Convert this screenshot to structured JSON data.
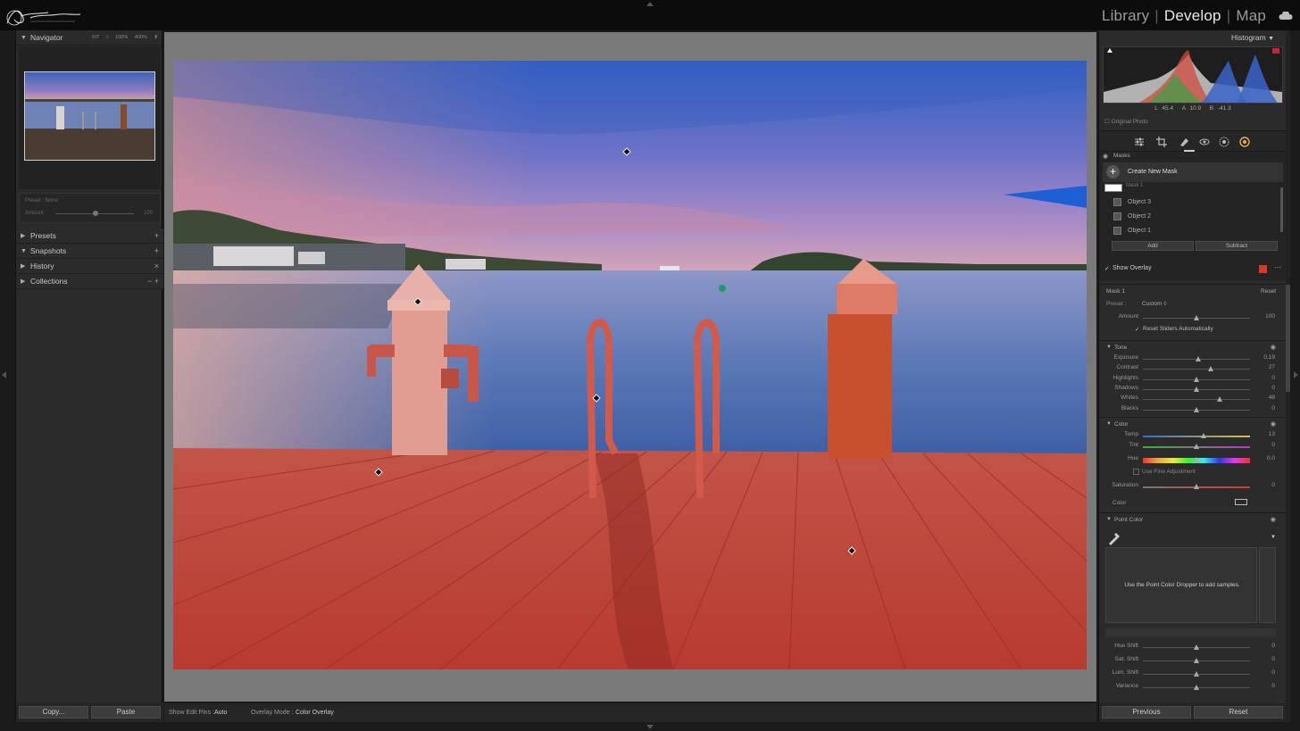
{
  "modules": {
    "library": "Library",
    "develop": "Develop",
    "map": "Map"
  },
  "navigator": {
    "title": "Navigator",
    "zoom_fit": "FIT ◊",
    "zoom_100": "100%",
    "zoom_400": "400%"
  },
  "preset_amount": {
    "preset_label": "Preset : None",
    "amount_label": "Amount",
    "amount_value": "100"
  },
  "left_sections": [
    {
      "label": "Presets",
      "action": "+"
    },
    {
      "label": "Snapshots",
      "action": "+"
    },
    {
      "label": "History",
      "action": "×"
    },
    {
      "label": "Collections",
      "action": "− +"
    }
  ],
  "left_buttons": {
    "copy": "Copy...",
    "paste": "Paste"
  },
  "toolbar": {
    "edit_pins_label": "Show Edit Pins :",
    "edit_pins_value": "Auto",
    "overlay_mode_label": "Overlay Mode :",
    "overlay_mode_value": "Color Overlay"
  },
  "histogram": {
    "title": "Histogram",
    "l_label": "L",
    "l_value": "45.4",
    "a_label": "A",
    "a_value": "10.9",
    "b_label": "B",
    "b_value": "-41.3",
    "original_photo": "Original Photo"
  },
  "masks": {
    "title": "Masks",
    "create_new": "Create New Mask",
    "mask_name": "Mask 1",
    "objects": [
      "Object 3",
      "Object 2",
      "Object 1"
    ],
    "add": "Add",
    "subtract": "Subtract",
    "show_overlay": "Show Overlay",
    "overlay_color": "#d83a2a"
  },
  "mask_panel": {
    "title": "Mask 1",
    "reset": "Reset",
    "preset_label": "Preset :",
    "preset_value": "Custom ◊",
    "amount_label": "Amount",
    "amount_value": "100",
    "reset_sliders": "Reset Sliders Automatically"
  },
  "tone": {
    "title": "Tone",
    "sliders": [
      {
        "label": "Exposure",
        "value": "0.19",
        "pos": 0.52
      },
      {
        "label": "Contrast",
        "value": "27",
        "pos": 0.63
      },
      {
        "label": "Highlights",
        "value": "0",
        "pos": 0.5
      },
      {
        "label": "Shadows",
        "value": "0",
        "pos": 0.5
      },
      {
        "label": "Whites",
        "value": "48",
        "pos": 0.72
      },
      {
        "label": "Blacks",
        "value": "0",
        "pos": 0.5
      }
    ]
  },
  "color": {
    "title": "Color",
    "temp_label": "Temp",
    "temp_value": "13",
    "temp_pos": 0.57,
    "tint_label": "Tint",
    "tint_value": "0",
    "tint_pos": 0.5,
    "hue_label": "Hue",
    "hue_value": "0.0",
    "hue_pos": 0.5,
    "fine_adjust": "Use Fine Adjustment",
    "saturation_label": "Saturation",
    "saturation_value": "0",
    "saturation_pos": 0.5,
    "color_label": "Color"
  },
  "point_color": {
    "title": "Point Color",
    "hint": "Use the Point Color Dropper to add samples.",
    "sliders": [
      {
        "label": "Hue Shift",
        "value": "0",
        "pos": 0.5
      },
      {
        "label": "Sat. Shift",
        "value": "0",
        "pos": 0.5
      },
      {
        "label": "Lum. Shift",
        "value": "0",
        "pos": 0.5
      },
      {
        "label": "Variance",
        "value": "0",
        "pos": 0.5
      }
    ]
  },
  "right_buttons": {
    "previous": "Previous",
    "reset": "Reset"
  }
}
